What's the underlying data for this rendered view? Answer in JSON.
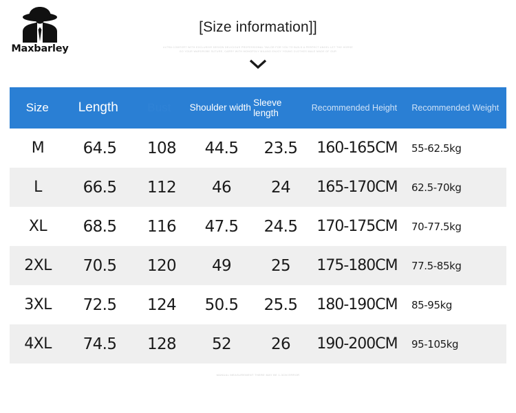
{
  "brand": {
    "name": "Maxbarley",
    "logo_icon": "person-in-hat-silhouette-icon"
  },
  "header": {
    "title": "[Size information]]",
    "subtitle": "ULTRA COMFORT WITH EXCLUSIVE DESIGN DELICIOUS PROFESSIONAL TAILOR FOR YOU TO BUILD A PERFECT ANGEL LET THE HORSE\nGO YOUR WARDROBE SUTURE, CARRY WITH MONOPOLY MILANO ENJOY YOUNG CLOTHES MALE MADE OF OUR",
    "chevron_icon": "chevron-down-icon"
  },
  "table": {
    "columns": [
      {
        "label": "Size"
      },
      {
        "label": "Length"
      },
      {
        "label": "Bust"
      },
      {
        "label": "Shoulder width"
      },
      {
        "label": "Sleeve length"
      },
      {
        "label": "Recommended Height"
      },
      {
        "label": "Recommended Weight"
      }
    ],
    "rows": [
      {
        "size": "M",
        "length": "64.5",
        "bust": "108",
        "shoulder": "44.5",
        "sleeve": "23.5",
        "height": "160-165CM",
        "weight": "55-62.5kg"
      },
      {
        "size": "L",
        "length": "66.5",
        "bust": "112",
        "shoulder": "46",
        "sleeve": "24",
        "height": "165-170CM",
        "weight": "62.5-70kg"
      },
      {
        "size": "XL",
        "length": "68.5",
        "bust": "116",
        "shoulder": "47.5",
        "sleeve": "24.5",
        "height": "170-175CM",
        "weight": "70-77.5kg"
      },
      {
        "size": "2XL",
        "length": "70.5",
        "bust": "120",
        "shoulder": "49",
        "sleeve": "25",
        "height": "175-180CM",
        "weight": "77.5-85kg"
      },
      {
        "size": "3XL",
        "length": "72.5",
        "bust": "124",
        "shoulder": "50.5",
        "sleeve": "25.5",
        "height": "180-190CM",
        "weight": "85-95kg"
      },
      {
        "size": "4XL",
        "length": "74.5",
        "bust": "128",
        "shoulder": "52",
        "sleeve": "26",
        "height": "190-200CM",
        "weight": "95-105kg"
      }
    ]
  },
  "footer": {
    "note": "MANUAL MEASUREMENT THERE MAY BE 1-3CM ERROR"
  },
  "colors": {
    "header_blue": "#2a7fd4",
    "stripe_gray": "#efefef",
    "text_dark": "#1a1a1a"
  }
}
